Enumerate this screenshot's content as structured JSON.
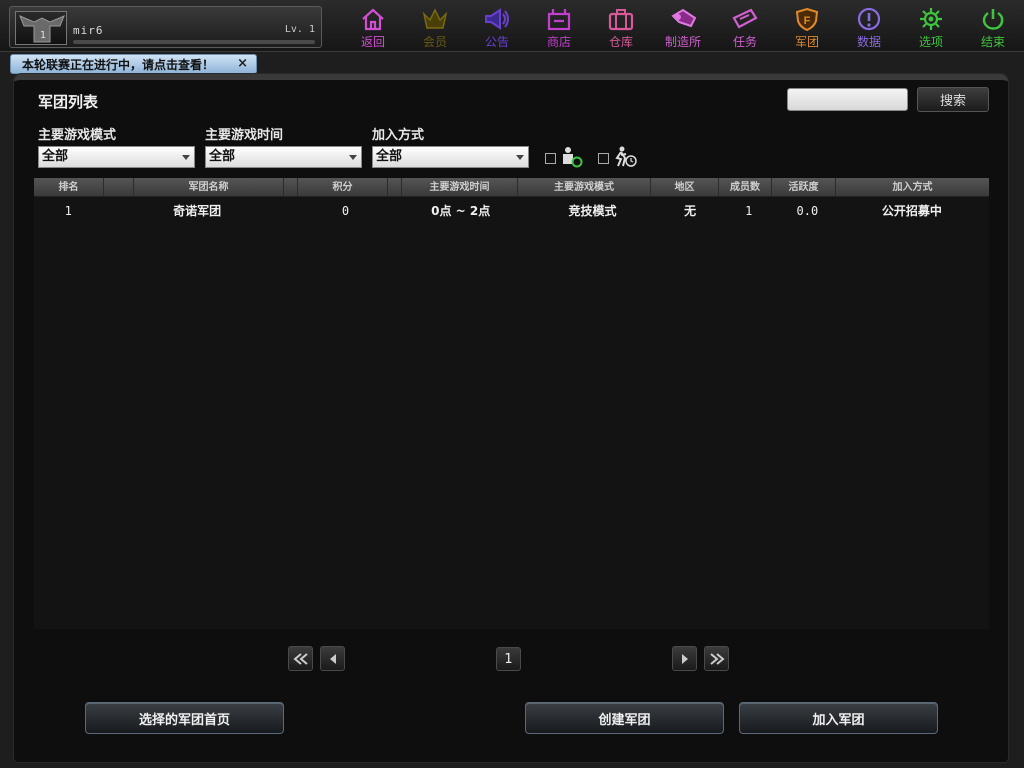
{
  "player": {
    "avatar_level": "1",
    "name": "mir6",
    "level": "Lv. 1",
    "exp_progress": 0
  },
  "nav": [
    {
      "id": "back",
      "label": "返回",
      "icon": "home-icon",
      "color": "#d24fd2"
    },
    {
      "id": "membership",
      "label": "会员",
      "icon": "crown-icon",
      "color": "#6a5a10"
    },
    {
      "id": "announcement",
      "label": "公告",
      "icon": "megaphone-icon",
      "color": "#6a3fd0"
    },
    {
      "id": "shop",
      "label": "商店",
      "icon": "shop-icon",
      "color": "#c23fd0"
    },
    {
      "id": "warehouse",
      "label": "仓库",
      "icon": "briefcase-icon",
      "color": "#d8589a"
    },
    {
      "id": "workshop",
      "label": "制造所",
      "icon": "wrench-icon",
      "color": "#d05fd0"
    },
    {
      "id": "mission",
      "label": "任务",
      "icon": "ticket-icon",
      "color": "#d05fd0"
    },
    {
      "id": "clan",
      "label": "军团",
      "icon": "shield-icon",
      "color": "#e08a2a"
    },
    {
      "id": "data",
      "label": "数据",
      "icon": "info-icon",
      "color": "#8a6ae0"
    },
    {
      "id": "options",
      "label": "选项",
      "icon": "gear-icon",
      "color": "#3ec43e"
    },
    {
      "id": "exit",
      "label": "结束",
      "icon": "power-icon",
      "color": "#3ec43e"
    }
  ],
  "notice": {
    "text": "本轮联赛正在进行中，请点击查看！",
    "close": "×"
  },
  "panel": {
    "title": "军团列表"
  },
  "search": {
    "value": "",
    "button": "搜索"
  },
  "filters": [
    {
      "label": "主要游戏模式",
      "value": "全部"
    },
    {
      "label": "主要游戏时间",
      "value": "全部"
    },
    {
      "label": "加入方式",
      "value": "全部"
    }
  ],
  "table": {
    "headers": [
      "排名",
      "",
      "军团名称",
      "",
      "积分",
      "",
      "主要游戏时间",
      "主要游戏模式",
      "地区",
      "成员数",
      "活跃度",
      "加入方式"
    ],
    "rows": [
      {
        "rank": "1",
        "name": "奇诺军团",
        "points": "0",
        "time": "0点 ~ 2点",
        "mode": "竞技模式",
        "region": "无",
        "members": "1",
        "activity": "0.0",
        "join": "公开招募中"
      }
    ]
  },
  "pagination": {
    "current": "1"
  },
  "buttons": {
    "clan_home": "选择的军团首页",
    "create": "创建军团",
    "join": "加入军团"
  }
}
